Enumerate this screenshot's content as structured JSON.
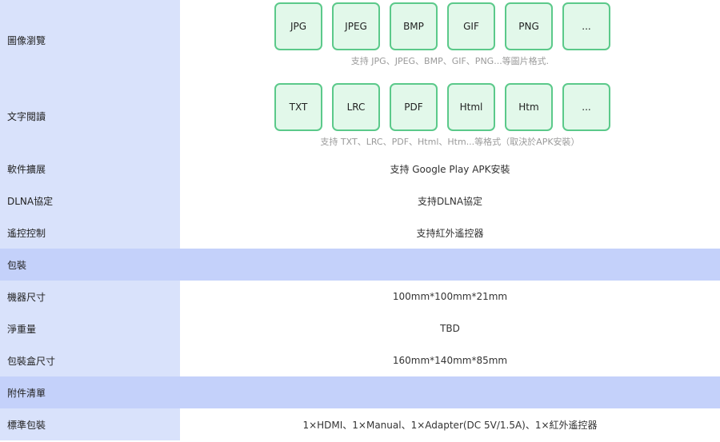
{
  "rows": {
    "image_preview": {
      "label": "圖像瀏覽",
      "formats": [
        "JPG",
        "JPEG",
        "BMP",
        "GIF",
        "PNG",
        "..."
      ],
      "note": "支持 JPG、JPEG、BMP、GIF、PNG...等圖片格式."
    },
    "text_reading": {
      "label": "文字閱讀",
      "formats": [
        "TXT",
        "LRC",
        "PDF",
        "Html",
        "Htm",
        "..."
      ],
      "note": "支持 TXT、LRC、PDF、Html、Htm...等格式（取決於APK安裝）"
    },
    "software_ext": {
      "label": "軟件擴展",
      "value": "支持 Google Play APK安裝"
    },
    "dlna": {
      "label": "DLNA協定",
      "value": "支持DLNA協定"
    },
    "remote": {
      "label": "遙控控制",
      "value": "支持紅外遙控器"
    },
    "packaging_header": {
      "label": "包裝"
    },
    "machine_size": {
      "label": "機器尺寸",
      "value": "100mm*100mm*21mm"
    },
    "net_weight": {
      "label": "淨重量",
      "value": "TBD"
    },
    "box_size": {
      "label": "包裝盒尺寸",
      "value": "160mm*140mm*85mm"
    },
    "accessories_header": {
      "label": "附件清單"
    },
    "standard_pack": {
      "label": "標準包裝",
      "value": "1×HDMI、1×Manual、1×Adapter(DC 5V/1.5A)、1×紅外遙控器"
    }
  }
}
